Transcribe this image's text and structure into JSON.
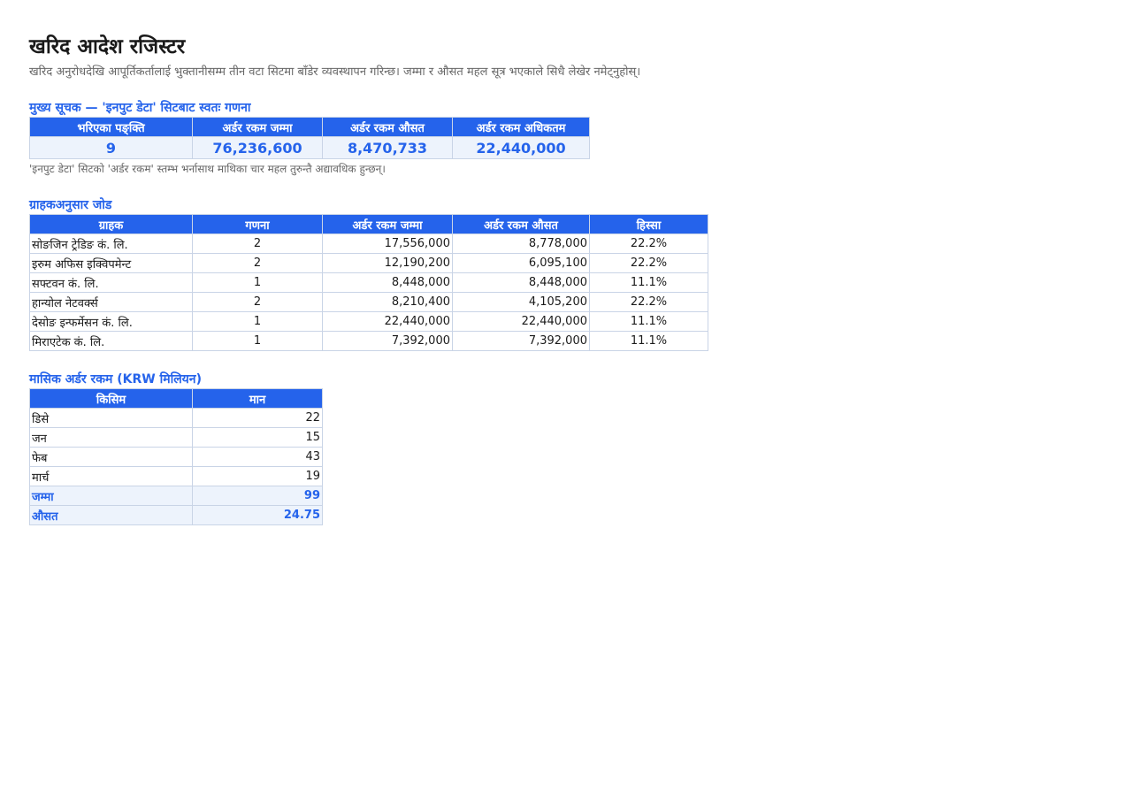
{
  "title": "खरिद आदेश रजिस्टर",
  "subtitle": "खरिद अनुरोधदेखि आपूर्तिकर्तालाई भुक्तानीसम्म तीन वटा सिटमा बाँडेर व्यवस्थापन गरिन्छ। जम्मा र औसत महल सूत्र भएकाले सिधै लेखेर नमेट्नुहोस्।",
  "kpi": {
    "section_title": "मुख्य सूचक — 'इनपुट डेटा' सिटबाट स्वतः गणना",
    "headers": [
      "भरिएका पङ्क्ति",
      "अर्डर रकम जम्मा",
      "अर्डर रकम औसत",
      "अर्डर रकम अधिकतम"
    ],
    "values": [
      "9",
      "76,236,600",
      "8,470,733",
      "22,440,000"
    ],
    "note": "'इनपुट डेटा' सिटको 'अर्डर रकम' स्तम्भ भर्नासाथ माथिका चार महल तुरुन्तै अद्यावधिक हुन्छन्।"
  },
  "by_customer": {
    "section_title": "ग्राहकअनुसार जोड",
    "headers": [
      "ग्राहक",
      "गणना",
      "अर्डर रकम जम्मा",
      "अर्डर रकम औसत",
      "हिस्सा"
    ],
    "rows": [
      [
        "सोङजिन ट्रेडिङ कं. लि.",
        "2",
        "17,556,000",
        "8,778,000",
        "22.2%"
      ],
      [
        "इरुम अफिस इक्विपमेन्ट",
        "2",
        "12,190,200",
        "6,095,100",
        "22.2%"
      ],
      [
        "सफ्टवन कं. लि.",
        "1",
        "8,448,000",
        "8,448,000",
        "11.1%"
      ],
      [
        "हान्योल नेटवर्क्स",
        "2",
        "8,210,400",
        "4,105,200",
        "22.2%"
      ],
      [
        "देसोङ इन्फर्मेसन कं. लि.",
        "1",
        "22,440,000",
        "22,440,000",
        "11.1%"
      ],
      [
        "मिराएटेक कं. लि.",
        "1",
        "7,392,000",
        "7,392,000",
        "11.1%"
      ]
    ]
  },
  "monthly": {
    "section_title": "मासिक अर्डर रकम (KRW मिलियन)",
    "headers": [
      "किसिम",
      "मान"
    ],
    "rows": [
      [
        "डिसे",
        "22"
      ],
      [
        "जन",
        "15"
      ],
      [
        "फेब",
        "43"
      ],
      [
        "मार्च",
        "19"
      ]
    ],
    "totals": [
      [
        "जम्मा",
        "99"
      ],
      [
        "औसत",
        "24.75"
      ]
    ]
  }
}
